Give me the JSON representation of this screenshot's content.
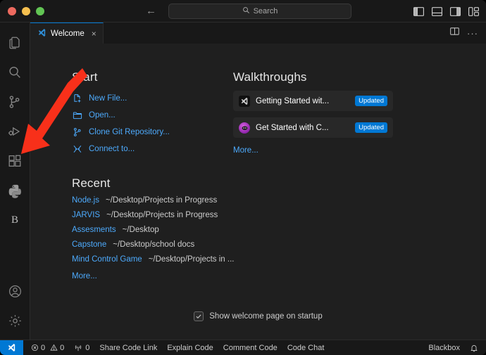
{
  "titlebar": {
    "traffic_lights": [
      "close",
      "minimize",
      "zoom"
    ],
    "nav_back": "←",
    "nav_forward": "→",
    "search_placeholder": "Search",
    "search_value": "",
    "layout_icons": [
      "toggle-primary-sidebar",
      "toggle-panel",
      "toggle-secondary-sidebar",
      "customize-layout"
    ]
  },
  "activitybar": {
    "items": [
      {
        "name": "explorer",
        "label": "Explorer",
        "active": false
      },
      {
        "name": "search",
        "label": "Search",
        "active": false
      },
      {
        "name": "source-control",
        "label": "Source Control",
        "active": false
      },
      {
        "name": "run-and-debug",
        "label": "Run and Debug",
        "active": false
      },
      {
        "name": "extensions",
        "label": "Extensions",
        "active": false
      },
      {
        "name": "python",
        "label": "Python",
        "active": false
      },
      {
        "name": "blackbox",
        "label": "B",
        "active": false
      }
    ],
    "bottom": [
      {
        "name": "accounts",
        "label": "Accounts"
      },
      {
        "name": "manage-settings",
        "label": "Manage"
      }
    ]
  },
  "tabs": [
    {
      "label": "Welcome",
      "icon": "vscode-icon",
      "active": true,
      "close": "×"
    }
  ],
  "editor_actions": {
    "split_editor": "split-editor-right",
    "more": "···"
  },
  "welcome": {
    "start": {
      "heading": "Start",
      "items": [
        {
          "icon": "new-file-icon",
          "label": "New File..."
        },
        {
          "icon": "folder-open-icon",
          "label": "Open..."
        },
        {
          "icon": "git-branch-icon",
          "label": "Clone Git Repository..."
        },
        {
          "icon": "remote-connect-icon",
          "label": "Connect to..."
        }
      ]
    },
    "recent": {
      "heading": "Recent",
      "items": [
        {
          "name": "Node.js",
          "path": "~/Desktop/Projects in Progress"
        },
        {
          "name": "JARVIS",
          "path": "~/Desktop/Projects in Progress"
        },
        {
          "name": "Assesments",
          "path": "~/Desktop"
        },
        {
          "name": "Capstone",
          "path": "~/Desktop/school docs"
        },
        {
          "name": "Mind Control Game",
          "path": "~/Desktop/Projects in ..."
        }
      ],
      "more": "More..."
    },
    "walkthroughs": {
      "heading": "Walkthroughs",
      "items": [
        {
          "icon": "vscode-logo-icon",
          "title": "Getting Started wit...",
          "badge": "Updated"
        },
        {
          "icon": "copilot-icon",
          "title": "Get Started with C...",
          "badge": "Updated"
        }
      ],
      "more": "More..."
    },
    "footer": {
      "checkbox_checked": true,
      "checkbox_label": "Show welcome page on startup"
    }
  },
  "statusbar": {
    "remote_icon": "remote-window-icon",
    "errors": "0",
    "warnings": "0",
    "ports": "0",
    "actions": [
      "Share Code Link",
      "Explain Code",
      "Comment Code",
      "Code Chat"
    ],
    "right_label": "Blackbox",
    "bell_icon": "bell-icon"
  },
  "annotation": {
    "type": "red-arrow",
    "color": "#f8301a",
    "points_to": "extensions"
  }
}
